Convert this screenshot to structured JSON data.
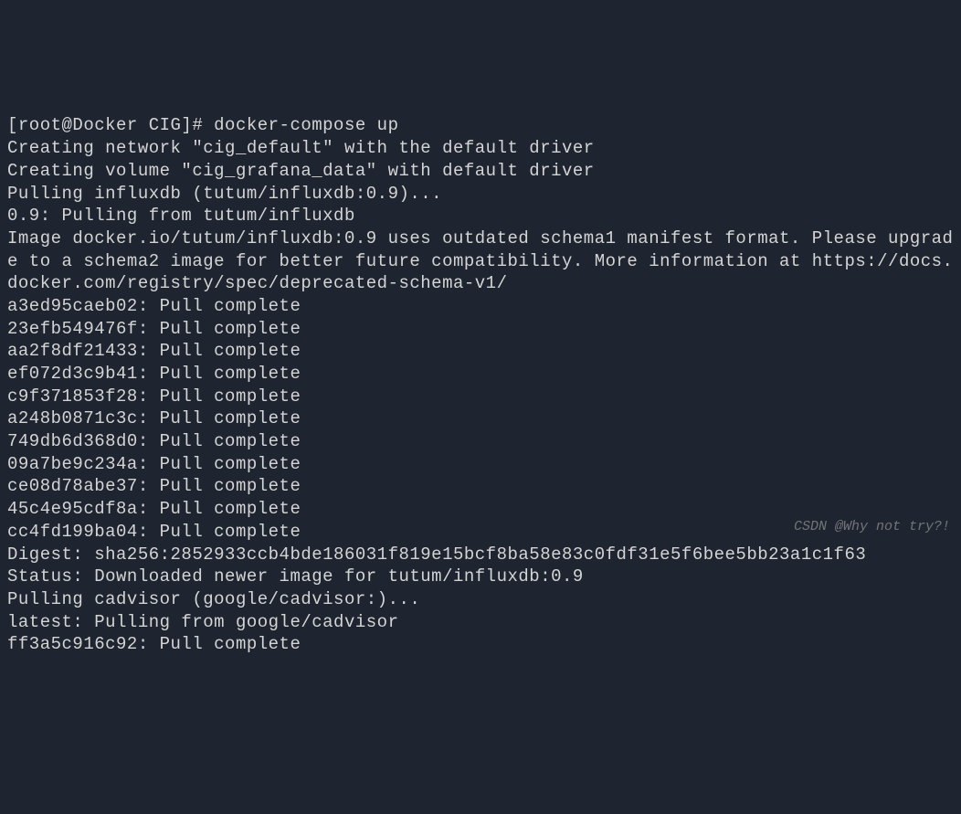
{
  "terminal": {
    "prompt": "[root@Docker CIG]# docker-compose up",
    "lines": [
      "Creating network \"cig_default\" with the default driver",
      "Creating volume \"cig_grafana_data\" with default driver",
      "Pulling influxdb (tutum/influxdb:0.9)...",
      "0.9: Pulling from tutum/influxdb",
      "Image docker.io/tutum/influxdb:0.9 uses outdated schema1 manifest format. Please upgrade to a schema2 image for better future compatibility. More information at https://docs.docker.com/registry/spec/deprecated-schema-v1/",
      "a3ed95caeb02: Pull complete",
      "23efb549476f: Pull complete",
      "aa2f8df21433: Pull complete",
      "ef072d3c9b41: Pull complete",
      "c9f371853f28: Pull complete",
      "a248b0871c3c: Pull complete",
      "749db6d368d0: Pull complete",
      "09a7be9c234a: Pull complete",
      "ce08d78abe37: Pull complete",
      "45c4e95cdf8a: Pull complete",
      "cc4fd199ba04: Pull complete",
      "Digest: sha256:2852933ccb4bde186031f819e15bcf8ba58e83c0fdf31e5f6bee5bb23a1c1f63",
      "Status: Downloaded newer image for tutum/influxdb:0.9",
      "Pulling cadvisor (google/cadvisor:)...",
      "latest: Pulling from google/cadvisor",
      "ff3a5c916c92: Pull complete"
    ]
  },
  "watermark": "CSDN @Why not try?!"
}
